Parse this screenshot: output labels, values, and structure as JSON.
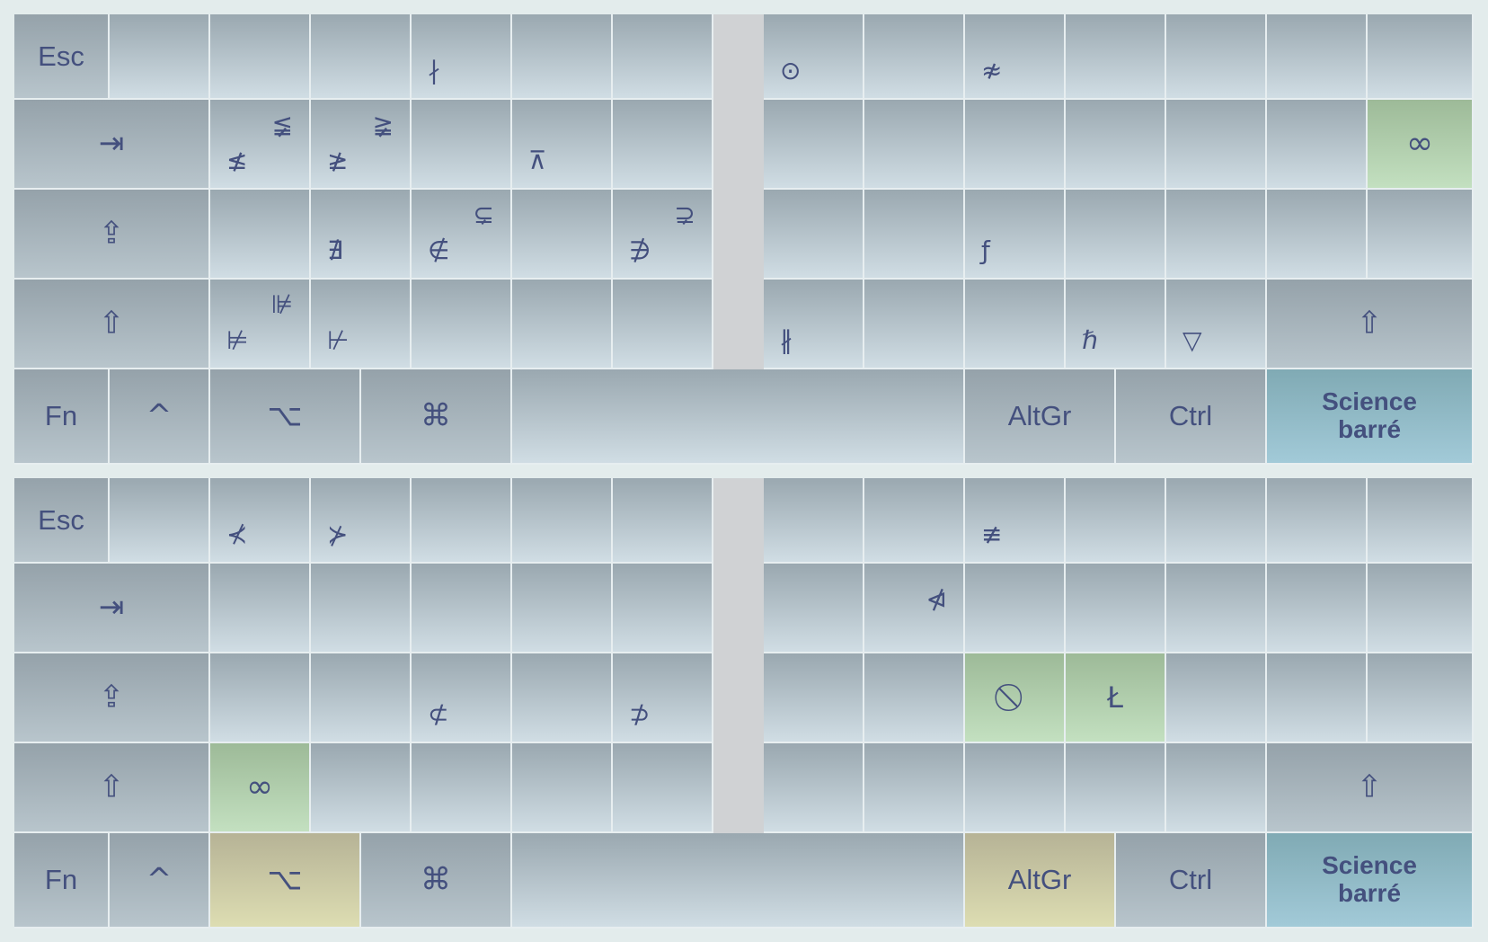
{
  "layout_name": "Science barré",
  "colors": {
    "key_gradient_top": "#9aa8b0",
    "key_gradient_bottom": "#d0dde4",
    "highlight_green": "#b1cdac",
    "highlight_yellow": "#c9c6a4",
    "highlight_blue": "#91bac6",
    "text": "#44507e"
  },
  "top_layer": {
    "row1": [
      "Esc",
      "",
      "",
      "",
      "∤",
      "",
      "",
      "⊙",
      "",
      "≉",
      "",
      "",
      "",
      ""
    ],
    "row2": {
      "tab_icon": "⇥",
      "keys": [
        {
          "low": "≰",
          "high": "≨"
        },
        {
          "low": "≱",
          "high": "≩"
        },
        {
          "low": "",
          "high": ""
        },
        {
          "low": "⊼",
          "high": ""
        },
        {
          "low": "",
          "high": ""
        },
        {
          "low": "",
          "high": ""
        },
        {
          "low": "",
          "high": ""
        },
        {
          "low": "",
          "high": ""
        },
        {
          "low": "",
          "high": ""
        },
        {
          "low": "",
          "high": ""
        },
        {
          "low": "",
          "high": ""
        },
        {
          "low": "∞",
          "high": ""
        }
      ]
    },
    "row3": {
      "capslock_icon": "⇪",
      "keys": [
        {
          "low": "",
          "high": ""
        },
        {
          "low": "∄",
          "high": ""
        },
        {
          "low": "∉",
          "high": "⊊"
        },
        {
          "low": "",
          "high": ""
        },
        {
          "low": "∌",
          "high": "⊋"
        },
        {
          "low": "",
          "high": ""
        },
        {
          "low": "",
          "high": ""
        },
        {
          "low": "ƒ",
          "high": ""
        },
        {
          "low": "",
          "high": ""
        },
        {
          "low": "",
          "high": ""
        },
        {
          "low": "",
          "high": ""
        },
        {
          "low": "",
          "high": ""
        }
      ]
    },
    "row4": {
      "shift_icon": "⇧",
      "keys": [
        {
          "low": "⊭",
          "high": "⊯"
        },
        {
          "low": "⊬",
          "high": ""
        },
        {
          "low": "",
          "high": ""
        },
        {
          "low": "",
          "high": ""
        },
        {
          "low": "",
          "high": ""
        },
        {
          "low": "∦",
          "high": ""
        },
        {
          "low": "",
          "high": ""
        },
        {
          "low": "",
          "high": ""
        },
        {
          "low": "ℏ",
          "high": ""
        },
        {
          "low": "▽",
          "high": ""
        }
      ],
      "right_shift_icon": "⇧"
    },
    "row5": [
      "Fn",
      "^",
      "⌥",
      "⌘",
      "",
      "AltGr",
      "Ctrl",
      "Science barré"
    ]
  },
  "bottom_layer": {
    "row1": [
      "Esc",
      "",
      "⊀",
      "⊁",
      "",
      "",
      "",
      "",
      "",
      "≢",
      "",
      "",
      "",
      ""
    ],
    "row2": {
      "tab_icon": "⇥",
      "keys": [
        {
          "low": "",
          "high": ""
        },
        {
          "low": "",
          "high": ""
        },
        {
          "low": "",
          "high": ""
        },
        {
          "low": "",
          "high": ""
        },
        {
          "low": "",
          "high": ""
        },
        {
          "low": "",
          "high": ""
        },
        {
          "low": "",
          "high": "⋪"
        },
        {
          "low": "",
          "high": ""
        },
        {
          "low": "",
          "high": ""
        },
        {
          "low": "",
          "high": ""
        },
        {
          "low": "",
          "high": ""
        },
        {
          "low": "",
          "high": ""
        }
      ]
    },
    "row3": {
      "capslock_icon": "⇪",
      "keys": [
        {
          "low": "",
          "high": ""
        },
        {
          "low": "",
          "high": ""
        },
        {
          "low": "⊄",
          "high": ""
        },
        {
          "low": "",
          "high": ""
        },
        {
          "low": "⊅",
          "high": ""
        },
        {
          "low": "",
          "high": ""
        },
        {
          "low": "",
          "high": ""
        },
        {
          "low": "⃠",
          "high": ""
        },
        {
          "low": "Ł",
          "high": ""
        },
        {
          "low": "",
          "high": ""
        },
        {
          "low": "",
          "high": ""
        },
        {
          "low": "",
          "high": ""
        }
      ]
    },
    "row4": {
      "shift_icon": "⇧",
      "keys": [
        {
          "low": "∞",
          "high": ""
        },
        {
          "low": "",
          "high": ""
        },
        {
          "low": "",
          "high": ""
        },
        {
          "low": "",
          "high": ""
        },
        {
          "low": "",
          "high": ""
        },
        {
          "low": "",
          "high": ""
        },
        {
          "low": "",
          "high": ""
        },
        {
          "low": "",
          "high": ""
        },
        {
          "low": "",
          "high": ""
        },
        {
          "low": "",
          "high": ""
        }
      ],
      "right_shift_icon": "⇧"
    },
    "row5": [
      "Fn",
      "^",
      "⌥",
      "⌘",
      "",
      "AltGr",
      "Ctrl",
      "Science barré"
    ]
  }
}
